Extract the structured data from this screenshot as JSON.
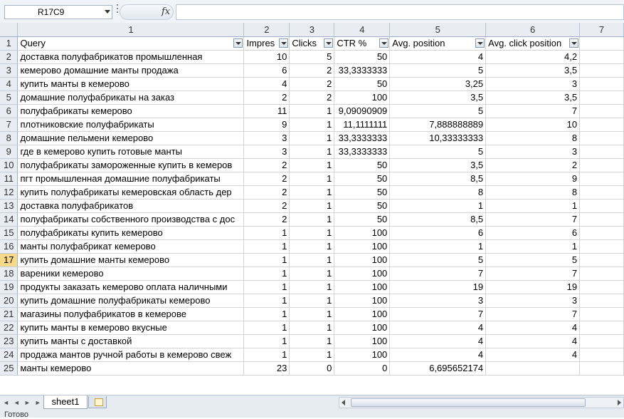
{
  "namebox": {
    "value": "R17C9"
  },
  "formula": {
    "fx_label": "fx",
    "value": ""
  },
  "columns": [
    "1",
    "2",
    "3",
    "4",
    "5",
    "6",
    "7"
  ],
  "headers": [
    "Query",
    "Impres",
    "Clicks",
    "CTR %",
    "Avg. position",
    "Avg. click position"
  ],
  "active_row": 17,
  "rows": [
    {
      "n": "2",
      "q": "доставка полуфабрикатов промышленная",
      "imp": "10",
      "clk": "5",
      "ctr": "50",
      "pos": "4",
      "cpos": "4,2"
    },
    {
      "n": "3",
      "q": "кемерово домашние манты продажа",
      "imp": "6",
      "clk": "2",
      "ctr": "33,3333333",
      "pos": "5",
      "cpos": "3,5"
    },
    {
      "n": "4",
      "q": "купить манты в кемерово",
      "imp": "4",
      "clk": "2",
      "ctr": "50",
      "pos": "3,25",
      "cpos": "3"
    },
    {
      "n": "5",
      "q": "домашние полуфабрикаты на заказ",
      "imp": "2",
      "clk": "2",
      "ctr": "100",
      "pos": "3,5",
      "cpos": "3,5"
    },
    {
      "n": "6",
      "q": "полуфабрикаты кемерово",
      "imp": "11",
      "clk": "1",
      "ctr": "9,09090909",
      "pos": "5",
      "cpos": "7"
    },
    {
      "n": "7",
      "q": "плотниковские полуфабрикаты",
      "imp": "9",
      "clk": "1",
      "ctr": "11,1111111",
      "pos": "7,888888889",
      "cpos": "10"
    },
    {
      "n": "8",
      "q": "домашние пельмени кемерово",
      "imp": "3",
      "clk": "1",
      "ctr": "33,3333333",
      "pos": "10,33333333",
      "cpos": "8"
    },
    {
      "n": "9",
      "q": "где в кемерово купить готовые манты",
      "imp": "3",
      "clk": "1",
      "ctr": "33,3333333",
      "pos": "5",
      "cpos": "3"
    },
    {
      "n": "10",
      "q": "полуфабрикаты замороженные купить в кемеров",
      "imp": "2",
      "clk": "1",
      "ctr": "50",
      "pos": "3,5",
      "cpos": "2"
    },
    {
      "n": "11",
      "q": "пгт промышленная домашние полуфабрикаты",
      "imp": "2",
      "clk": "1",
      "ctr": "50",
      "pos": "8,5",
      "cpos": "9"
    },
    {
      "n": "12",
      "q": "купить полуфабрикаты кемеровская область дер",
      "imp": "2",
      "clk": "1",
      "ctr": "50",
      "pos": "8",
      "cpos": "8"
    },
    {
      "n": "13",
      "q": "доставка полуфабрикатов",
      "imp": "2",
      "clk": "1",
      "ctr": "50",
      "pos": "1",
      "cpos": "1"
    },
    {
      "n": "14",
      "q": "полуфабрикаты собственного производства с дос",
      "imp": "2",
      "clk": "1",
      "ctr": "50",
      "pos": "8,5",
      "cpos": "7"
    },
    {
      "n": "15",
      "q": "полуфабрикаты купить кемерово",
      "imp": "1",
      "clk": "1",
      "ctr": "100",
      "pos": "6",
      "cpos": "6"
    },
    {
      "n": "16",
      "q": "манты полуфабрикат кемерово",
      "imp": "1",
      "clk": "1",
      "ctr": "100",
      "pos": "1",
      "cpos": "1"
    },
    {
      "n": "17",
      "q": "купить домашние манты кемерово",
      "imp": "1",
      "clk": "1",
      "ctr": "100",
      "pos": "5",
      "cpos": "5"
    },
    {
      "n": "18",
      "q": "вареники кемерово",
      "imp": "1",
      "clk": "1",
      "ctr": "100",
      "pos": "7",
      "cpos": "7"
    },
    {
      "n": "19",
      "q": "продукты заказать кемерово оплата наличными",
      "imp": "1",
      "clk": "1",
      "ctr": "100",
      "pos": "19",
      "cpos": "19"
    },
    {
      "n": "20",
      "q": "купить домашние полуфабрикаты кемерово",
      "imp": "1",
      "clk": "1",
      "ctr": "100",
      "pos": "3",
      "cpos": "3"
    },
    {
      "n": "21",
      "q": "магазины полуфабрикатов в кемерове",
      "imp": "1",
      "clk": "1",
      "ctr": "100",
      "pos": "7",
      "cpos": "7"
    },
    {
      "n": "22",
      "q": "купить манты в кемерово вкусные",
      "imp": "1",
      "clk": "1",
      "ctr": "100",
      "pos": "4",
      "cpos": "4"
    },
    {
      "n": "23",
      "q": "купить манты с доставкой",
      "imp": "1",
      "clk": "1",
      "ctr": "100",
      "pos": "4",
      "cpos": "4"
    },
    {
      "n": "24",
      "q": "продажа мантов ручной работы в кемерово свеж",
      "imp": "1",
      "clk": "1",
      "ctr": "100",
      "pos": "4",
      "cpos": "4"
    },
    {
      "n": "25",
      "q": "манты кемерово",
      "imp": "23",
      "clk": "0",
      "ctr": "0",
      "pos": "6,695652174",
      "cpos": ""
    }
  ],
  "sheet_tab": "sheet1",
  "status_text": "Готово"
}
